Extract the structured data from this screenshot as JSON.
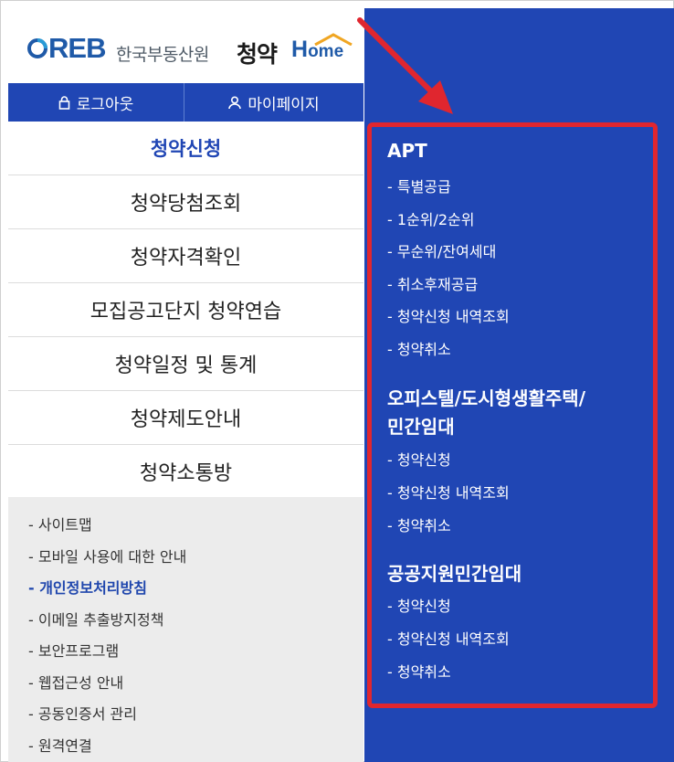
{
  "logo": {
    "reb": "REB",
    "korean": "한국부동산원",
    "cheongyak": "청약",
    "home_h": "H",
    "home_rest": "ome"
  },
  "topbar": {
    "logout": "로그아웃",
    "mypage": "마이페이지"
  },
  "menu": [
    "청약신청",
    "청약당첨조회",
    "청약자격확인",
    "모집공고단지 청약연습",
    "청약일정 및 통계",
    "청약제도안내",
    "청약소통방"
  ],
  "footer_links": [
    "- 사이트맵",
    "- 모바일 사용에 대한 안내",
    "- 개인정보처리방침",
    "- 이메일 추출방지정책",
    "- 보안프로그램",
    "- 웹접근성 안내",
    "- 공동인증서 관리",
    "- 원격연결"
  ],
  "submenu": {
    "apt": {
      "title": "APT",
      "items": [
        "- 특별공급",
        "- 1순위/2순위",
        "- 무순위/잔여세대",
        "- 취소후재공급",
        "- 청약신청 내역조회",
        "- 청약취소"
      ]
    },
    "officetel": {
      "title_line1": "오피스텔/도시형생활주택/",
      "title_line2": "민간임대",
      "items": [
        "- 청약신청",
        "- 청약신청 내역조회",
        "- 청약취소"
      ]
    },
    "public": {
      "title": "공공지원민간임대",
      "items": [
        "- 청약신청",
        "- 청약신청 내역조회",
        "- 청약취소"
      ]
    }
  },
  "colors": {
    "brand_blue": "#2046b4",
    "highlight_red": "#e0262f"
  },
  "icons": {
    "logout": "lock-icon",
    "mypage": "person-icon",
    "logo": "reb-logo-mark"
  }
}
